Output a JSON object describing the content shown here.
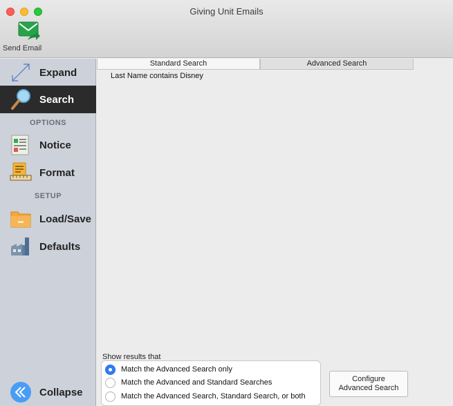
{
  "window": {
    "title": "Giving Unit Emails"
  },
  "toolbar": {
    "send_email_label": "Send Email"
  },
  "sidebar": {
    "expand_label": "Expand",
    "search_label": "Search",
    "options_header": "OPTIONS",
    "notice_label": "Notice",
    "format_label": "Format",
    "setup_header": "SETUP",
    "loadsave_label": "Load/Save",
    "defaults_label": "Defaults",
    "collapse_label": "Collapse"
  },
  "tabs": {
    "standard": "Standard Search",
    "advanced": "Advanced Search"
  },
  "criteria_text": "Last Name contains Disney",
  "results": {
    "label": "Show results that",
    "options": [
      "Match the Advanced Search only",
      "Match the Advanced and Standard Searches",
      "Match the Advanced Search, Standard Search, or both"
    ],
    "selected_index": 0
  },
  "configure_button": {
    "line1": "Configure",
    "line2": "Advanced Search"
  },
  "colors": {
    "accent": "#2f7cf6",
    "sidebar": "#cdd1d9",
    "active_item": "#2b2b2b"
  }
}
